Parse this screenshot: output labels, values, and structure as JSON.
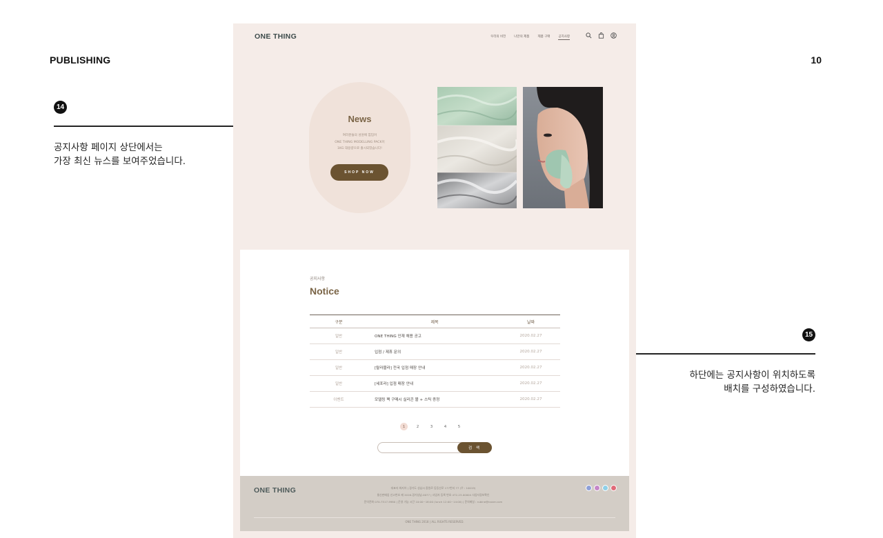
{
  "presentation": {
    "section_title": "PUBLISHING",
    "page_number": "10",
    "callouts": [
      {
        "number": "14",
        "lines": [
          "공지사항 페이지 상단에서는",
          "가장 최신 뉴스를 보여주었습니다."
        ]
      },
      {
        "number": "15",
        "lines": [
          "하단에는 공지사항이 위치하도록",
          "배치를 구성하였습니다."
        ]
      }
    ]
  },
  "site": {
    "brand": "ONE THING",
    "nav": [
      {
        "label": "우리의 비전",
        "active": false
      },
      {
        "label": "나만의 제품",
        "active": false
      },
      {
        "label": "제품 구매",
        "active": false
      },
      {
        "label": "공지사항",
        "active": true
      }
    ],
    "header_icons": [
      "search-icon",
      "shopping-bag-icon",
      "user-icon"
    ],
    "hero": {
      "title": "News",
      "description": [
        "여러분들의 성원에 힘입어",
        "ONE THING MODELLING PACK이",
        "1KG 대용량으로 출시되었습니다!"
      ],
      "button_label": "SHOP NOW"
    },
    "notice": {
      "subtitle": "공지사항",
      "title": "Notice",
      "columns": [
        "구분",
        "제목",
        "날짜"
      ],
      "rows": [
        {
          "category": "일반",
          "title": "ONE THING 인재 채용 공고",
          "date": "2020.02.27"
        },
        {
          "category": "일반",
          "title": "입점 / 제휴 문의",
          "date": "2020.02.27"
        },
        {
          "category": "일반",
          "title": "[랄라블라] 전국 입점 매장 안내",
          "date": "2020.02.27"
        },
        {
          "category": "일반",
          "title": "[세포라] 입점 매장 안내",
          "date": "2020.02.27"
        },
        {
          "category": "이벤트",
          "title": "모델링 팩 구매시 실리콘 볼 + 스틱 증정",
          "date": "2020.02.27"
        }
      ],
      "pages": [
        "1",
        "2",
        "3",
        "4",
        "5"
      ],
      "current_page": "1",
      "search_value": "",
      "search_button": "검 색"
    },
    "footer": {
      "brand": "ONE THING",
      "info": [
        "대표자 최지아  |  경기도 성남시 중원로 등등산로 177번지 77 (우 : 10019)",
        "통신판매업 신고번호 제 2016-경기성남-0077  |  사업자 등록 번호 472-23-00004 사업자정보확인",
        "문의전화 070-7517-9980  |  운영 가능 시간 10:00~18:00 (lunch 12:00~14:00)  |  문의메일 : rubine@naver.com"
      ],
      "social": [
        {
          "icon": "facebook-icon",
          "color": "#8ea0d8"
        },
        {
          "icon": "instagram-icon",
          "color": "#c586c9"
        },
        {
          "icon": "twitter-icon",
          "color": "#8fd0e8"
        },
        {
          "icon": "youtube-icon",
          "color": "#e06a78"
        }
      ],
      "copyright": "ONE THING 2018  |  ALL RIGHTS RESERVED."
    }
  },
  "colors": {
    "brand_brown": "#6b5331",
    "page_background": "#f5ece8",
    "footer_background": "#d3cdc6",
    "title_brown": "#7a6446"
  }
}
